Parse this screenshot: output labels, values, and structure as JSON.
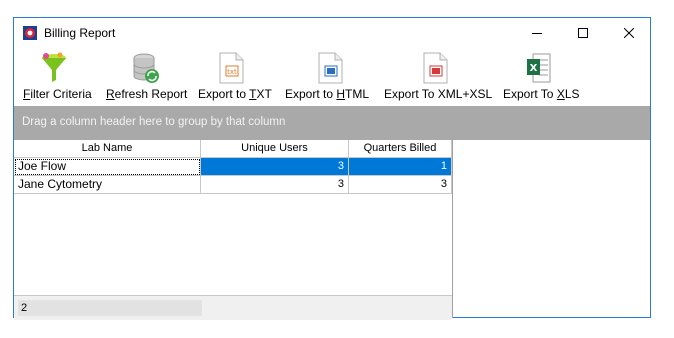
{
  "window": {
    "title": "Billing Report"
  },
  "toolbar": {
    "filter_label_pre": "F",
    "filter_label_rest": "ilter Criteria",
    "refresh_label_pre": "R",
    "refresh_label_rest": "efresh Report",
    "txt_label_pre": "Export to ",
    "txt_label_ul": "T",
    "txt_label_rest": "XT",
    "html_label_pre": "Export to ",
    "html_label_ul": "H",
    "html_label_rest": "TML",
    "xml_label": "Export To XML+XSL",
    "xls_label_pre": "Export To ",
    "xls_label_ul": "X",
    "xls_label_rest": "LS"
  },
  "group_panel": {
    "text": "Drag a column header here to group by that column"
  },
  "grid": {
    "columns": [
      "Lab Name",
      "Unique Users",
      "Quarters Billed"
    ],
    "rows": [
      {
        "lab": "Joe Flow",
        "users": "3",
        "quarters": "1"
      },
      {
        "lab": "Jane Cytometry",
        "users": "3",
        "quarters": "3"
      }
    ]
  },
  "footer": {
    "count": "2"
  }
}
